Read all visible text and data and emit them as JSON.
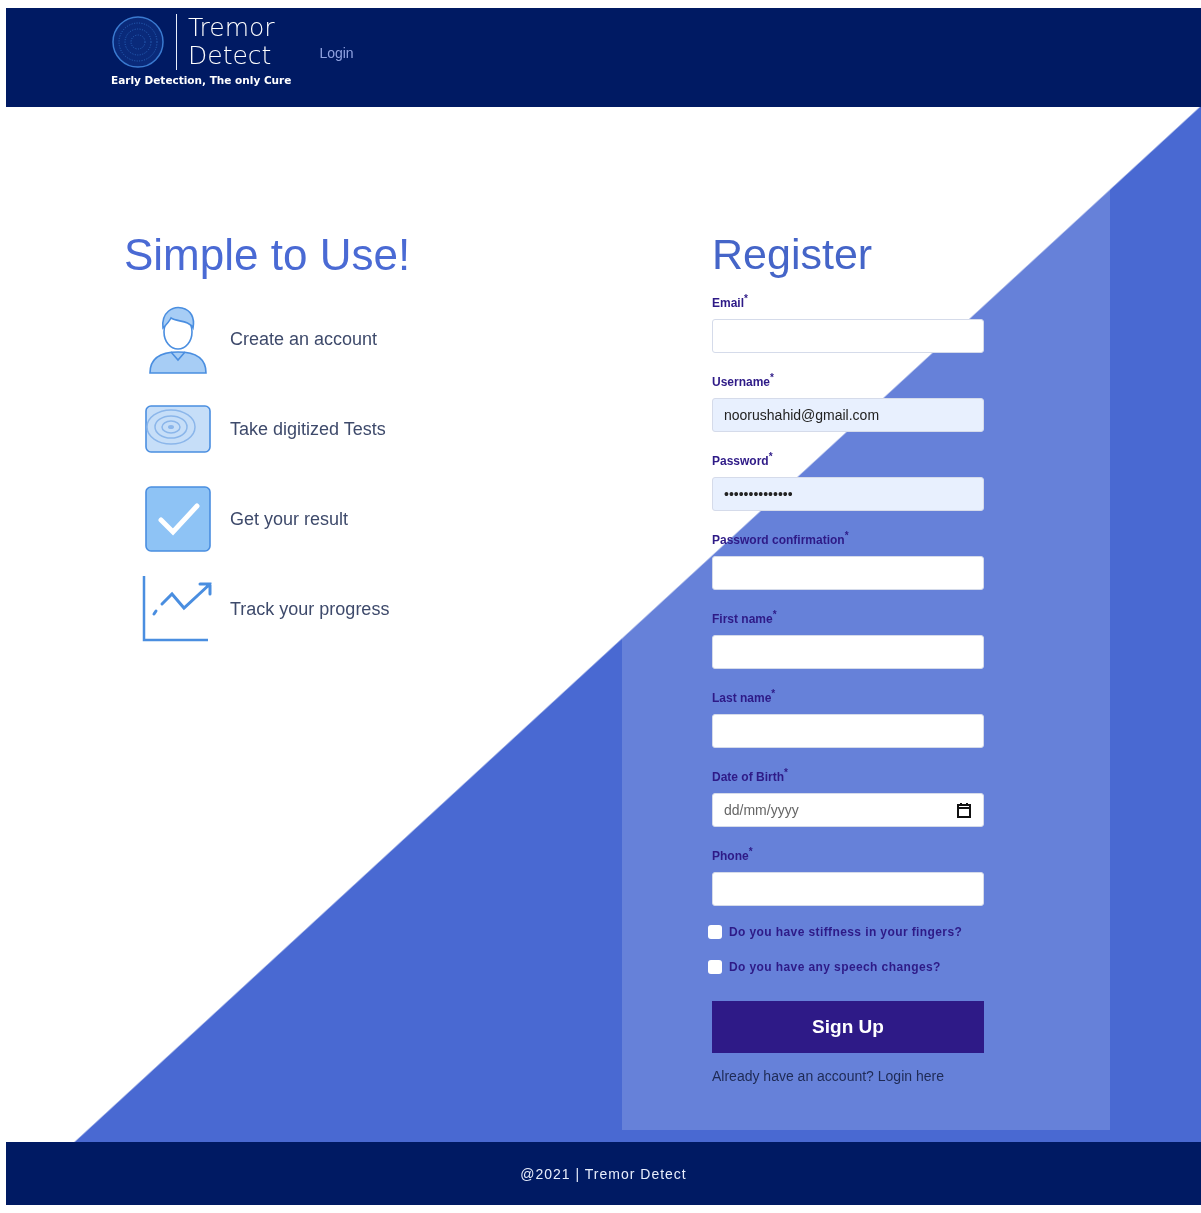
{
  "header": {
    "brand_top": "Tremor",
    "brand_bottom": "Detect",
    "tagline": "Early Detection, The only Cure",
    "nav": [
      "Login"
    ]
  },
  "intro": {
    "title": "Simple to Use!",
    "steps": [
      {
        "kind": "account",
        "text": "Create an account"
      },
      {
        "kind": "test",
        "text": "Take digitized Tests"
      },
      {
        "kind": "result",
        "text": "Get your result"
      },
      {
        "kind": "progress",
        "text": "Track your progress"
      }
    ]
  },
  "form": {
    "title": "Register",
    "fields": [
      {
        "kind": "text",
        "label": "Email$^{*}$"
      },
      {
        "kind": "autofill",
        "label": "Username$^{*}$",
        "value": "noorushahid@gmail.com"
      },
      {
        "kind": "autofill",
        "label": "Password$^{*}$",
        "value": "••••••••••••••"
      },
      {
        "kind": "text",
        "label": "Password confirmation$^{*}$"
      },
      {
        "kind": "text",
        "label": "First name$^{*}$"
      },
      {
        "kind": "text",
        "label": "Last name$^{*}$"
      },
      {
        "kind": "date",
        "label": "Date of Birth$^{*}$",
        "placeholder": "dd/mm/yyyy"
      },
      {
        "kind": "text",
        "label": "Phone$^{*}$"
      }
    ],
    "checks": [
      {
        "label": "Do you have stiffness in your fingers?",
        "checked": false
      },
      {
        "label": "Do you have any speech changes?",
        "checked": false
      }
    ],
    "submit": "Sign Up",
    "prompt": "Already have an account?",
    "prompt_link": "Login here"
  },
  "footer": "@2021 | Tremor Detect"
}
